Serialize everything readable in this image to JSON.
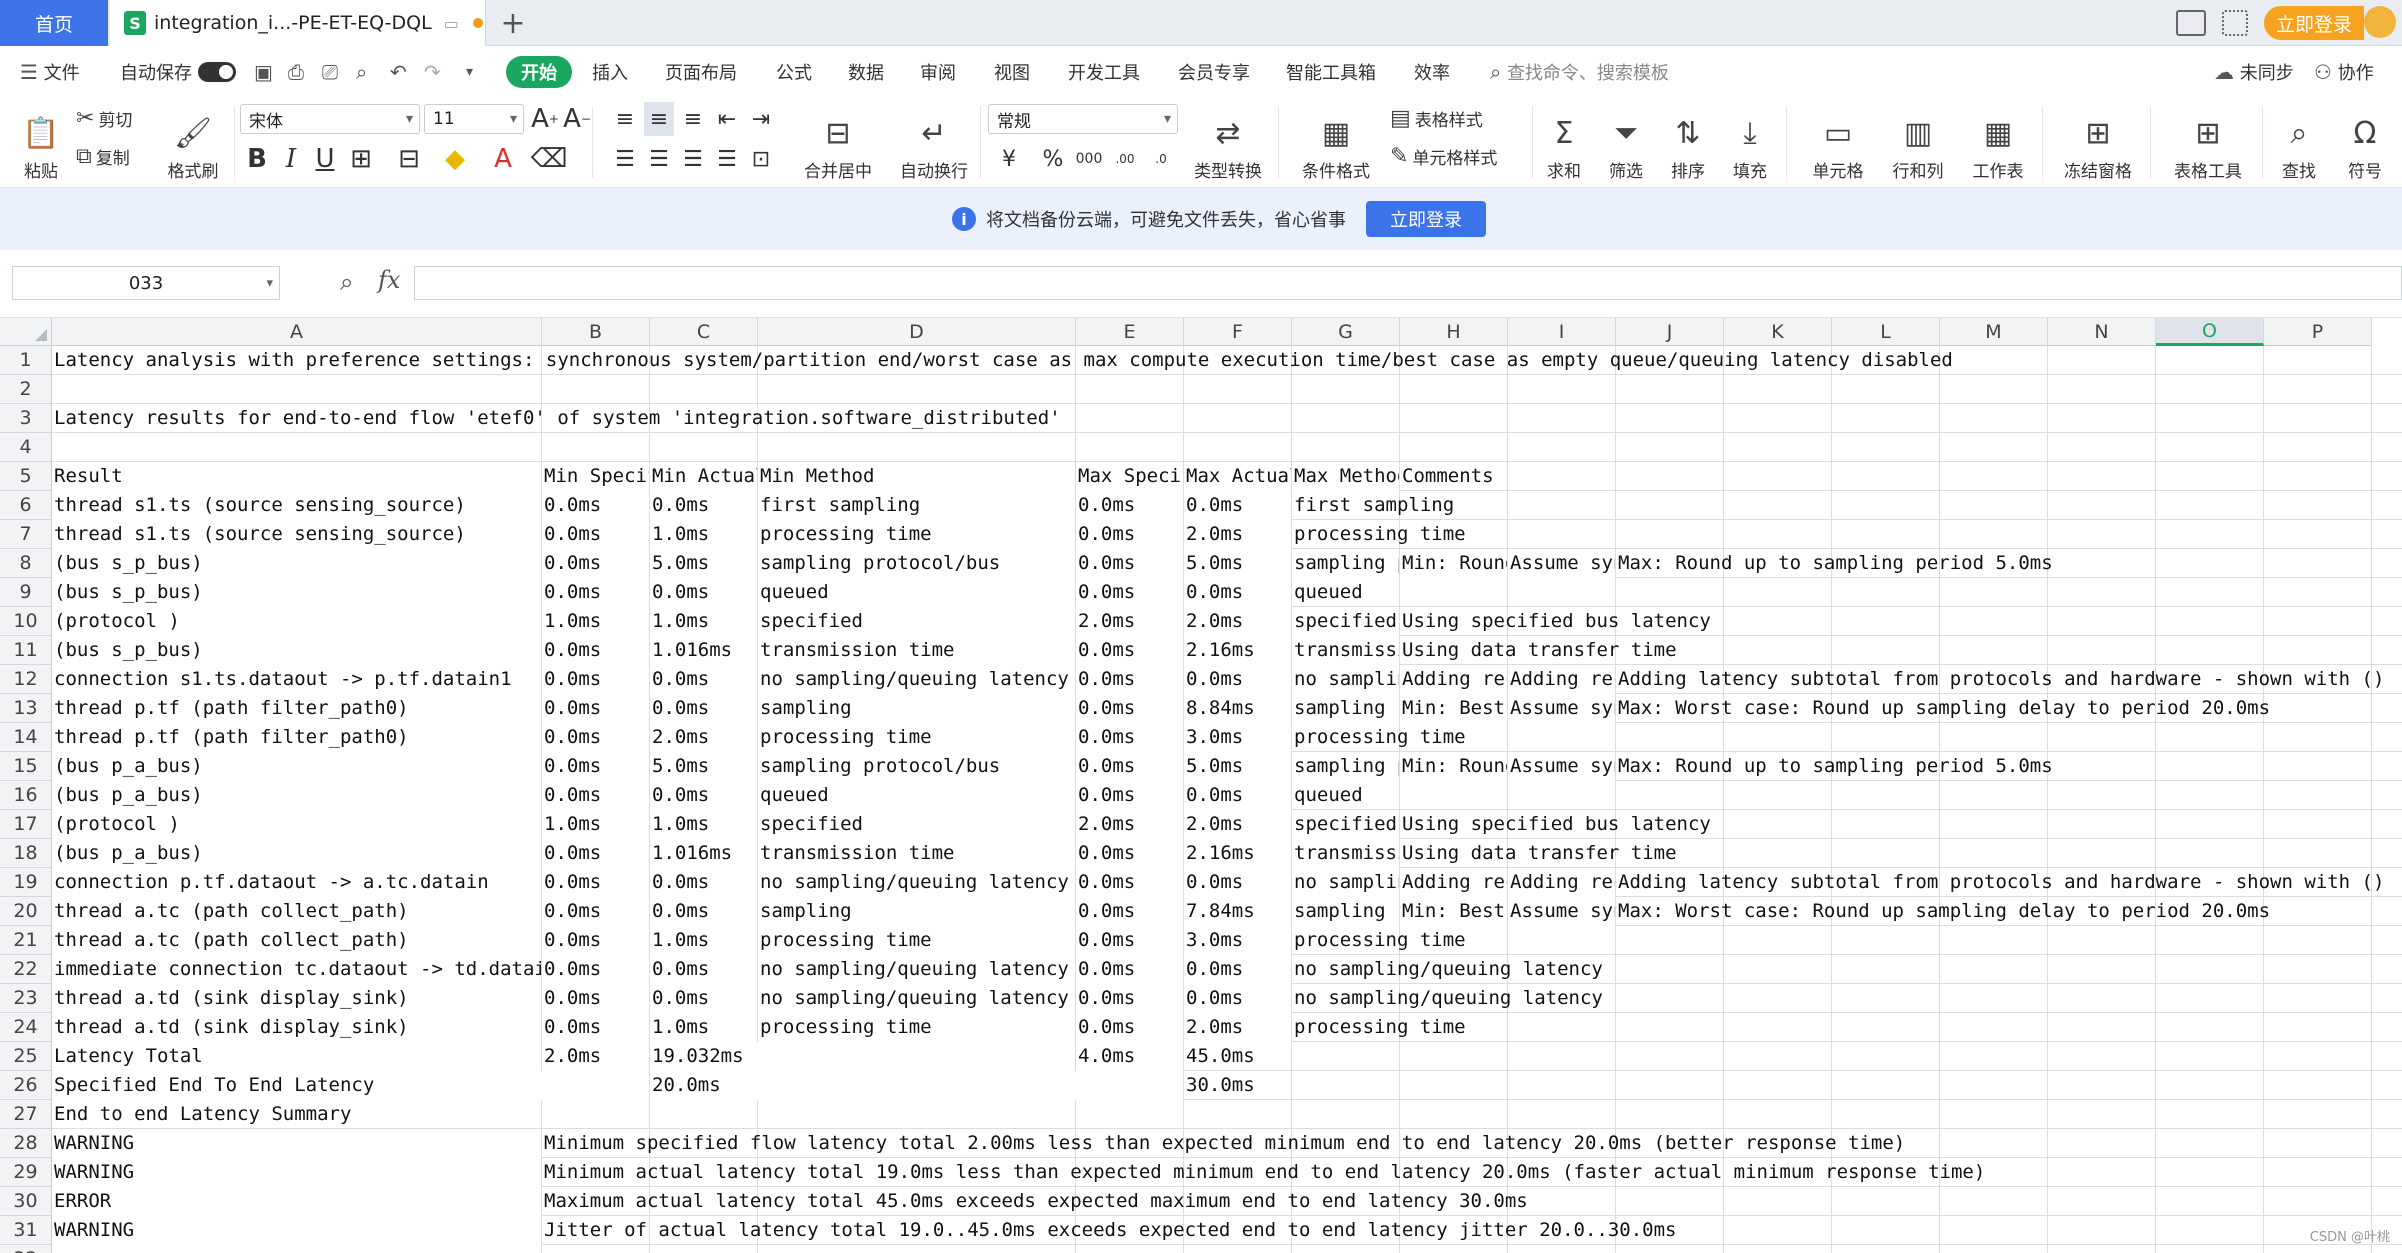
{
  "tabs": {
    "home": "首页",
    "doc_title": "integration_i...-PE-ET-EQ-DQL",
    "new_tab": "+"
  },
  "topright": {
    "login": "立即登录"
  },
  "menu": {
    "file": "文件",
    "autosave": "自动保存",
    "start": "开始",
    "items": [
      "插入",
      "页面布局",
      "公式",
      "数据",
      "审阅",
      "视图",
      "开发工具",
      "会员专享",
      "智能工具箱",
      "效率"
    ],
    "search_placeholder": "查找命令、搜索模板",
    "unsync": "未同步",
    "collab": "协作"
  },
  "ribbon": {
    "paste": "粘贴",
    "cut": "剪切",
    "copy": "复制",
    "format_painter": "格式刷",
    "font": "宋体",
    "size": "11",
    "merge": "合并居中",
    "wrap": "自动换行",
    "numfmt": "常规",
    "convert": "类型转换",
    "cond_fmt": "条件格式",
    "table_style": "表格样式",
    "cell_style": "单元格样式",
    "sum": "求和",
    "filter": "筛选",
    "sort": "排序",
    "fill": "填充",
    "cell": "单元格",
    "rowcol": "行和列",
    "sheet": "工作表",
    "freeze": "冻结窗格",
    "table_tools": "表格工具",
    "find": "查找",
    "symbol": "符号"
  },
  "banner": {
    "text": "将文档备份云端，可避免文件丢失，省心省事",
    "button": "立即登录"
  },
  "formula_bar": {
    "name_box": "033",
    "formula": ""
  },
  "columns": [
    "A",
    "B",
    "C",
    "D",
    "E",
    "F",
    "G",
    "H",
    "I",
    "J",
    "K",
    "L",
    "M",
    "N",
    "O",
    "P"
  ],
  "selected_column": "O",
  "rows": [
    {
      "n": "1",
      "cells": [
        {
          "c": "A",
          "v": "Latency analysis with preference settings: synchronous system/partition end/worst case as max compute execution time/best case as empty queue/queuing latency disabled"
        }
      ]
    },
    {
      "n": "2",
      "cells": []
    },
    {
      "n": "3",
      "cells": [
        {
          "c": "A",
          "v": "Latency results for end-to-end flow 'etef0' of system 'integration.software_distributed'"
        }
      ]
    },
    {
      "n": "4",
      "cells": []
    },
    {
      "n": "5",
      "cells": [
        {
          "c": "A",
          "v": "Result"
        },
        {
          "c": "B",
          "v": "Min Specified"
        },
        {
          "c": "C",
          "v": "Min Actual"
        },
        {
          "c": "D",
          "v": "Min Method"
        },
        {
          "c": "E",
          "v": "Max Specified"
        },
        {
          "c": "F",
          "v": "Max Actual"
        },
        {
          "c": "G",
          "v": "Max Method"
        },
        {
          "c": "H",
          "v": "Comments"
        }
      ]
    },
    {
      "n": "6",
      "cells": [
        {
          "c": "A",
          "v": "thread s1.ts (source sensing_source)"
        },
        {
          "c": "B",
          "v": "0.0ms"
        },
        {
          "c": "C",
          "v": "0.0ms"
        },
        {
          "c": "D",
          "v": "first sampling"
        },
        {
          "c": "E",
          "v": "0.0ms"
        },
        {
          "c": "F",
          "v": "0.0ms"
        },
        {
          "c": "G",
          "v": "first sampling"
        }
      ]
    },
    {
      "n": "7",
      "cells": [
        {
          "c": "A",
          "v": "thread s1.ts (source sensing_source)"
        },
        {
          "c": "B",
          "v": "0.0ms"
        },
        {
          "c": "C",
          "v": "1.0ms"
        },
        {
          "c": "D",
          "v": "processing time"
        },
        {
          "c": "E",
          "v": "0.0ms"
        },
        {
          "c": "F",
          "v": "2.0ms"
        },
        {
          "c": "G",
          "v": "processing time"
        }
      ]
    },
    {
      "n": "8",
      "cells": [
        {
          "c": "A",
          "v": "(bus s_p_bus)"
        },
        {
          "c": "B",
          "v": "0.0ms"
        },
        {
          "c": "C",
          "v": "5.0ms"
        },
        {
          "c": "D",
          "v": "sampling protocol/bus"
        },
        {
          "c": "E",
          "v": "0.0ms"
        },
        {
          "c": "F",
          "v": "5.0ms"
        },
        {
          "c": "G",
          "v": "sampling protocol/bus"
        },
        {
          "c": "H",
          "v": "Min: Round up to sampling period"
        },
        {
          "c": "I",
          "v": "Assume synchronous"
        },
        {
          "c": "J",
          "v": "Max: Round up to sampling period 5.0ms"
        }
      ]
    },
    {
      "n": "9",
      "cells": [
        {
          "c": "A",
          "v": "(bus s_p_bus)"
        },
        {
          "c": "B",
          "v": "0.0ms"
        },
        {
          "c": "C",
          "v": "0.0ms"
        },
        {
          "c": "D",
          "v": "queued"
        },
        {
          "c": "E",
          "v": "0.0ms"
        },
        {
          "c": "F",
          "v": "0.0ms"
        },
        {
          "c": "G",
          "v": "queued"
        }
      ]
    },
    {
      "n": "10",
      "cells": [
        {
          "c": "A",
          "v": "(protocol )"
        },
        {
          "c": "B",
          "v": "1.0ms"
        },
        {
          "c": "C",
          "v": "1.0ms"
        },
        {
          "c": "D",
          "v": "specified"
        },
        {
          "c": "E",
          "v": "2.0ms"
        },
        {
          "c": "F",
          "v": "2.0ms"
        },
        {
          "c": "G",
          "v": "specified"
        },
        {
          "c": "H",
          "v": "Using specified bus latency"
        }
      ]
    },
    {
      "n": "11",
      "cells": [
        {
          "c": "A",
          "v": "(bus s_p_bus)"
        },
        {
          "c": "B",
          "v": "0.0ms"
        },
        {
          "c": "C",
          "v": "1.016ms"
        },
        {
          "c": "D",
          "v": "transmission time"
        },
        {
          "c": "E",
          "v": "0.0ms"
        },
        {
          "c": "F",
          "v": "2.16ms"
        },
        {
          "c": "G",
          "v": "transmission time"
        },
        {
          "c": "H",
          "v": "Using data transfer time"
        }
      ]
    },
    {
      "n": "12",
      "cells": [
        {
          "c": "A",
          "v": "connection s1.ts.dataout -> p.tf.datain1"
        },
        {
          "c": "B",
          "v": "0.0ms"
        },
        {
          "c": "C",
          "v": "0.0ms"
        },
        {
          "c": "D",
          "v": "no sampling/queuing latency"
        },
        {
          "c": "E",
          "v": "0.0ms"
        },
        {
          "c": "F",
          "v": "0.0ms"
        },
        {
          "c": "G",
          "v": "no sampling/queuing latency"
        },
        {
          "c": "H",
          "v": "Adding recursive"
        },
        {
          "c": "I",
          "v": "Adding recursive"
        },
        {
          "c": "J",
          "v": "Adding latency subtotal from protocols and hardware - shown with ()"
        }
      ]
    },
    {
      "n": "13",
      "cells": [
        {
          "c": "A",
          "v": "thread p.tf (path filter_path0)"
        },
        {
          "c": "B",
          "v": "0.0ms"
        },
        {
          "c": "C",
          "v": "0.0ms"
        },
        {
          "c": "D",
          "v": "sampling"
        },
        {
          "c": "E",
          "v": "0.0ms"
        },
        {
          "c": "F",
          "v": "8.84ms"
        },
        {
          "c": "G",
          "v": "sampling"
        },
        {
          "c": "H",
          "v": "Min: Best case"
        },
        {
          "c": "I",
          "v": "Assume synchronous"
        },
        {
          "c": "J",
          "v": "Max: Worst case: Round up sampling delay to period 20.0ms"
        }
      ]
    },
    {
      "n": "14",
      "cells": [
        {
          "c": "A",
          "v": "thread p.tf (path filter_path0)"
        },
        {
          "c": "B",
          "v": "0.0ms"
        },
        {
          "c": "C",
          "v": "2.0ms"
        },
        {
          "c": "D",
          "v": "processing time"
        },
        {
          "c": "E",
          "v": "0.0ms"
        },
        {
          "c": "F",
          "v": "3.0ms"
        },
        {
          "c": "G",
          "v": "processing time"
        }
      ]
    },
    {
      "n": "15",
      "cells": [
        {
          "c": "A",
          "v": "(bus p_a_bus)"
        },
        {
          "c": "B",
          "v": "0.0ms"
        },
        {
          "c": "C",
          "v": "5.0ms"
        },
        {
          "c": "D",
          "v": "sampling protocol/bus"
        },
        {
          "c": "E",
          "v": "0.0ms"
        },
        {
          "c": "F",
          "v": "5.0ms"
        },
        {
          "c": "G",
          "v": "sampling protocol/bus"
        },
        {
          "c": "H",
          "v": "Min: Round up to sampling period"
        },
        {
          "c": "I",
          "v": "Assume synchronous"
        },
        {
          "c": "J",
          "v": "Max: Round up to sampling period 5.0ms"
        }
      ]
    },
    {
      "n": "16",
      "cells": [
        {
          "c": "A",
          "v": "(bus p_a_bus)"
        },
        {
          "c": "B",
          "v": "0.0ms"
        },
        {
          "c": "C",
          "v": "0.0ms"
        },
        {
          "c": "D",
          "v": "queued"
        },
        {
          "c": "E",
          "v": "0.0ms"
        },
        {
          "c": "F",
          "v": "0.0ms"
        },
        {
          "c": "G",
          "v": "queued"
        }
      ]
    },
    {
      "n": "17",
      "cells": [
        {
          "c": "A",
          "v": "(protocol )"
        },
        {
          "c": "B",
          "v": "1.0ms"
        },
        {
          "c": "C",
          "v": "1.0ms"
        },
        {
          "c": "D",
          "v": "specified"
        },
        {
          "c": "E",
          "v": "2.0ms"
        },
        {
          "c": "F",
          "v": "2.0ms"
        },
        {
          "c": "G",
          "v": "specified"
        },
        {
          "c": "H",
          "v": "Using specified bus latency"
        }
      ]
    },
    {
      "n": "18",
      "cells": [
        {
          "c": "A",
          "v": "(bus p_a_bus)"
        },
        {
          "c": "B",
          "v": "0.0ms"
        },
        {
          "c": "C",
          "v": "1.016ms"
        },
        {
          "c": "D",
          "v": "transmission time"
        },
        {
          "c": "E",
          "v": "0.0ms"
        },
        {
          "c": "F",
          "v": "2.16ms"
        },
        {
          "c": "G",
          "v": "transmission time"
        },
        {
          "c": "H",
          "v": "Using data transfer time"
        }
      ]
    },
    {
      "n": "19",
      "cells": [
        {
          "c": "A",
          "v": "connection p.tf.dataout -> a.tc.datain"
        },
        {
          "c": "B",
          "v": "0.0ms"
        },
        {
          "c": "C",
          "v": "0.0ms"
        },
        {
          "c": "D",
          "v": "no sampling/queuing latency"
        },
        {
          "c": "E",
          "v": "0.0ms"
        },
        {
          "c": "F",
          "v": "0.0ms"
        },
        {
          "c": "G",
          "v": "no sampling/queuing latency"
        },
        {
          "c": "H",
          "v": "Adding recursive"
        },
        {
          "c": "I",
          "v": "Adding recursive"
        },
        {
          "c": "J",
          "v": "Adding latency subtotal from protocols and hardware - shown with ()"
        }
      ]
    },
    {
      "n": "20",
      "cells": [
        {
          "c": "A",
          "v": "thread a.tc (path collect_path)"
        },
        {
          "c": "B",
          "v": "0.0ms"
        },
        {
          "c": "C",
          "v": "0.0ms"
        },
        {
          "c": "D",
          "v": "sampling"
        },
        {
          "c": "E",
          "v": "0.0ms"
        },
        {
          "c": "F",
          "v": "7.84ms"
        },
        {
          "c": "G",
          "v": "sampling"
        },
        {
          "c": "H",
          "v": "Min: Best case"
        },
        {
          "c": "I",
          "v": "Assume synchronous"
        },
        {
          "c": "J",
          "v": "Max: Worst case: Round up sampling delay to period 20.0ms"
        }
      ]
    },
    {
      "n": "21",
      "cells": [
        {
          "c": "A",
          "v": "thread a.tc (path collect_path)"
        },
        {
          "c": "B",
          "v": "0.0ms"
        },
        {
          "c": "C",
          "v": "1.0ms"
        },
        {
          "c": "D",
          "v": "processing time"
        },
        {
          "c": "E",
          "v": "0.0ms"
        },
        {
          "c": "F",
          "v": "3.0ms"
        },
        {
          "c": "G",
          "v": "processing time"
        }
      ]
    },
    {
      "n": "22",
      "cells": [
        {
          "c": "A",
          "v": "immediate connection tc.dataout -> td.datain"
        },
        {
          "c": "B",
          "v": "0.0ms"
        },
        {
          "c": "C",
          "v": "0.0ms"
        },
        {
          "c": "D",
          "v": "no sampling/queuing latency"
        },
        {
          "c": "E",
          "v": "0.0ms"
        },
        {
          "c": "F",
          "v": "0.0ms"
        },
        {
          "c": "G",
          "v": "no sampling/queuing latency"
        }
      ]
    },
    {
      "n": "23",
      "cells": [
        {
          "c": "A",
          "v": "thread a.td (sink display_sink)"
        },
        {
          "c": "B",
          "v": "0.0ms"
        },
        {
          "c": "C",
          "v": "0.0ms"
        },
        {
          "c": "D",
          "v": "no sampling/queuing latency"
        },
        {
          "c": "E",
          "v": "0.0ms"
        },
        {
          "c": "F",
          "v": "0.0ms"
        },
        {
          "c": "G",
          "v": "no sampling/queuing latency"
        }
      ]
    },
    {
      "n": "24",
      "cells": [
        {
          "c": "A",
          "v": "thread a.td (sink display_sink)"
        },
        {
          "c": "B",
          "v": "0.0ms"
        },
        {
          "c": "C",
          "v": "1.0ms"
        },
        {
          "c": "D",
          "v": "processing time"
        },
        {
          "c": "E",
          "v": "0.0ms"
        },
        {
          "c": "F",
          "v": "2.0ms"
        },
        {
          "c": "G",
          "v": "processing time"
        }
      ]
    },
    {
      "n": "25",
      "cells": [
        {
          "c": "A",
          "v": "Latency Total"
        },
        {
          "c": "B",
          "v": "2.0ms"
        },
        {
          "c": "C",
          "v": "19.032ms"
        },
        {
          "c": "E",
          "v": "4.0ms"
        },
        {
          "c": "F",
          "v": "45.0ms"
        }
      ]
    },
    {
      "n": "26",
      "cells": [
        {
          "c": "A",
          "v": "Specified End To End Latency"
        },
        {
          "c": "C",
          "v": "20.0ms"
        },
        {
          "c": "F",
          "v": "30.0ms"
        }
      ]
    },
    {
      "n": "27",
      "cells": [
        {
          "c": "A",
          "v": "End to end Latency Summary"
        }
      ]
    },
    {
      "n": "28",
      "cells": [
        {
          "c": "A",
          "v": "WARNING"
        },
        {
          "c": "B",
          "v": "Minimum specified flow latency total 2.00ms less than expected minimum end to end latency 20.0ms (better response time)"
        }
      ]
    },
    {
      "n": "29",
      "cells": [
        {
          "c": "A",
          "v": "WARNING"
        },
        {
          "c": "B",
          "v": "Minimum actual latency total 19.0ms less than expected minimum end to end latency 20.0ms (faster actual minimum response time)"
        }
      ]
    },
    {
      "n": "30",
      "cells": [
        {
          "c": "A",
          "v": "ERROR"
        },
        {
          "c": "B",
          "v": "Maximum actual latency total 45.0ms exceeds expected maximum end to end latency 30.0ms"
        }
      ]
    },
    {
      "n": "31",
      "cells": [
        {
          "c": "A",
          "v": "WARNING"
        },
        {
          "c": "B",
          "v": "Jitter of actual latency total 19.0..45.0ms exceeds expected end to end latency jitter 20.0..30.0ms"
        }
      ]
    },
    {
      "n": "32",
      "cells": []
    }
  ],
  "watermark": "CSDN @叶桃"
}
